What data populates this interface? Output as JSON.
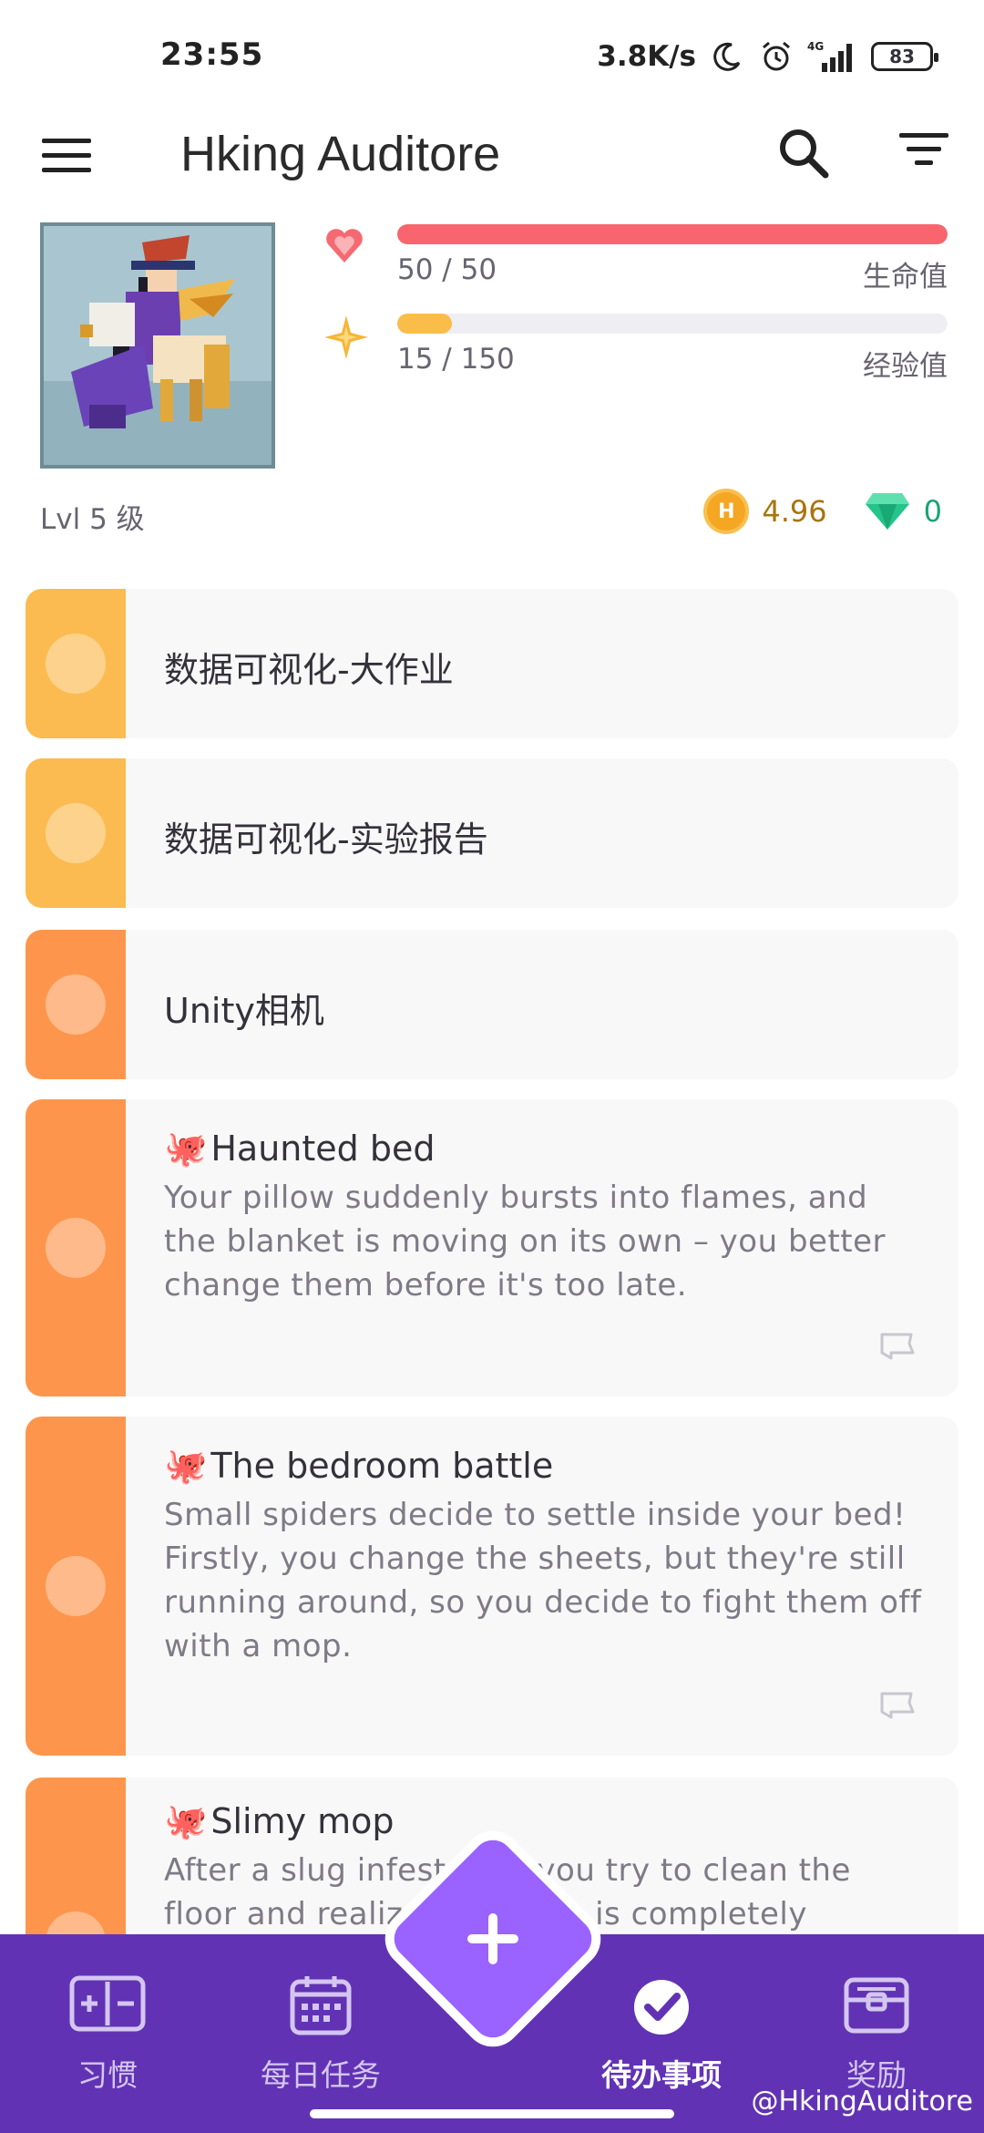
{
  "status_bar": {
    "time": "23:55",
    "network_speed": "3.8K/s",
    "network_type": "4G",
    "battery": "83",
    "icons": [
      "moon-icon",
      "alarm-icon",
      "signal-icon",
      "battery-icon"
    ]
  },
  "app_bar": {
    "title": "Hking Auditore",
    "icons": [
      "menu-icon",
      "search-icon",
      "filter-icon"
    ]
  },
  "profile": {
    "health": {
      "value": "50 / 50",
      "label": "生命值",
      "fraction": 1.0,
      "color": "#f8656e"
    },
    "experience": {
      "value": "15 / 150",
      "label": "经验值",
      "fraction": 0.1,
      "color": "#fbbd4a"
    },
    "level": "Lvl 5 级",
    "gold": "4.96",
    "gold_symbol": "H",
    "gems": "0"
  },
  "tasks": [
    {
      "title": "数据可视化-大作业",
      "notes": "",
      "color": "#fcbb50",
      "emoji": ""
    },
    {
      "title": "数据可视化-实验报告",
      "notes": "",
      "color": "#fcbb50",
      "emoji": ""
    },
    {
      "title": "Unity相机",
      "notes": "",
      "color": "#fd964c",
      "emoji": ""
    },
    {
      "title": "Haunted bed",
      "emoji": "🐙",
      "notes": "Your pillow suddenly bursts into flames, and the blanket is moving on its own – you better change them before it's too late.",
      "color": "#fd964c"
    },
    {
      "title": "The bedroom battle",
      "emoji": "🐙",
      "notes": "Small spiders decide to settle inside your bed! Firstly, you change the sheets, but they're still running around, so you decide to fight them off with a mop.",
      "color": "#fd964c"
    },
    {
      "title": "Slimy mop",
      "emoji": "🐙",
      "notes": "After a slug infestation you try to clean the floor and realize your mop is completely",
      "color": "#fd964c"
    }
  ],
  "bottom_nav": {
    "items": [
      {
        "label": "习惯",
        "icon": "habits-icon",
        "active": false
      },
      {
        "label": "每日任务",
        "icon": "calendar-icon",
        "active": false
      },
      {
        "label": "待办事项",
        "icon": "checkmark-icon",
        "active": true
      },
      {
        "label": "奖励",
        "icon": "treasure-chest-icon",
        "active": false
      }
    ],
    "fab_icon": "plus-icon"
  },
  "watermark": "@HkingAuditore",
  "colors": {
    "nav_bg": "#6133b4",
    "fab": "#9a62ff",
    "card_bg": "#f8f8f8"
  }
}
